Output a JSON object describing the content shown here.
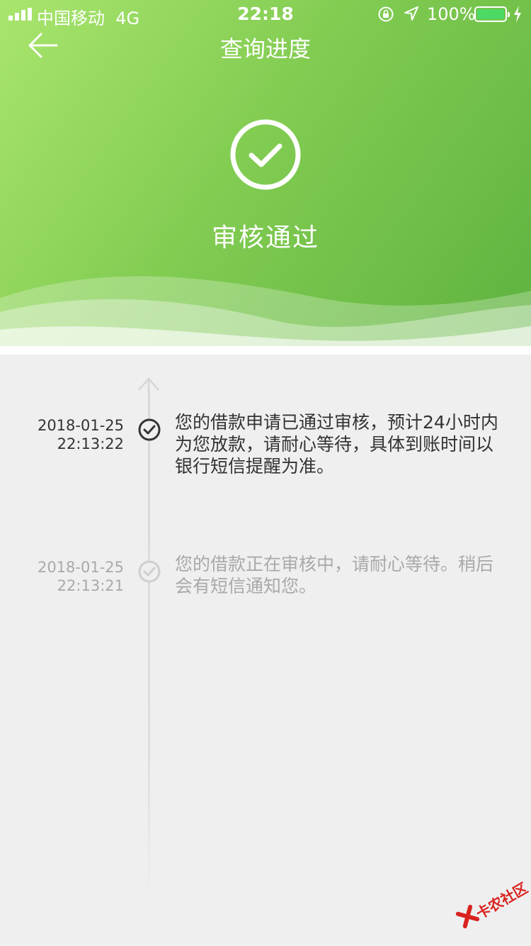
{
  "status_bar": {
    "carrier": "中国移动",
    "network": "4G",
    "time": "22:18",
    "battery_percent": "100%",
    "battery_color": "#4cd964"
  },
  "header": {
    "title": "查询进度",
    "back_icon": "arrow-left-icon",
    "status_icon": "check-circle-icon",
    "status_text": "审核通过",
    "gradient_colors": [
      "#a9e56d",
      "#82cc52",
      "#5eb23f"
    ]
  },
  "timeline": [
    {
      "date": "2018-01-25",
      "time": "22:13:22",
      "text": "您的借款申请已通过审核，预计24小时内为您放款，请耐心等待，具体到账时间以银行短信提醒为准。",
      "state": "current",
      "color": "#333333"
    },
    {
      "date": "2018-01-25",
      "time": "22:13:21",
      "text": "您的借款正在审核中，请耐心等待。稍后会有短信通知您。",
      "state": "past",
      "color": "#a9a9a9"
    }
  ],
  "watermark": {
    "text": "卡农社区",
    "color": "#d9231f"
  }
}
